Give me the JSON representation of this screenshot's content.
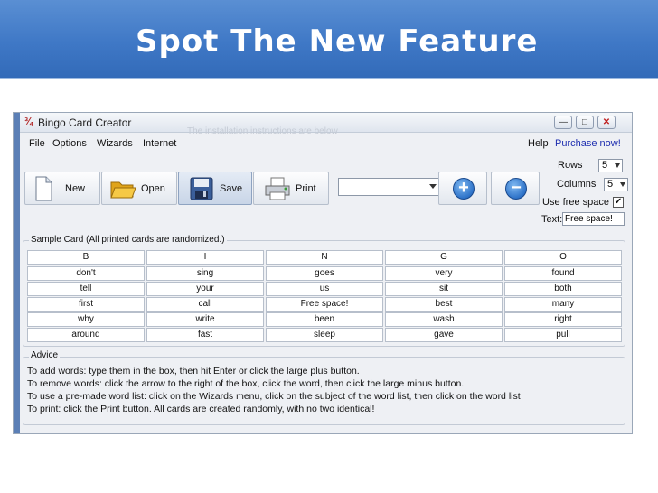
{
  "slide": {
    "title": "Spot The New Feature"
  },
  "window": {
    "title": "Bingo Card Creator",
    "ghost_text": "The installation instructions are below",
    "controls": {
      "minimize": "—",
      "maximize": "□",
      "close": "✕"
    }
  },
  "menu": {
    "file": "File",
    "options": "Options",
    "wizards": "Wizards",
    "internet": "Internet",
    "help": "Help",
    "purchase": "Purchase now!"
  },
  "toolbar": {
    "new_label": "New",
    "open_label": "Open",
    "save_label": "Save",
    "print_label": "Print",
    "word_combo_value": "",
    "add_symbol": "+",
    "remove_symbol": "−"
  },
  "settings": {
    "rows_label": "Rows",
    "rows_value": "5",
    "columns_label": "Columns",
    "columns_value": "5",
    "free_space_label": "Use free space",
    "free_space_checked": "✔",
    "text_label": "Text:",
    "text_value": "Free space!"
  },
  "sample_card": {
    "title": "Sample Card (All printed cards are randomized.)",
    "headers": [
      "B",
      "I",
      "N",
      "G",
      "O"
    ],
    "rows": [
      [
        "don't",
        "sing",
        "goes",
        "very",
        "found"
      ],
      [
        "tell",
        "your",
        "us",
        "sit",
        "both"
      ],
      [
        "first",
        "call",
        "Free space!",
        "best",
        "many"
      ],
      [
        "why",
        "write",
        "been",
        "wash",
        "right"
      ],
      [
        "around",
        "fast",
        "sleep",
        "gave",
        "pull"
      ]
    ]
  },
  "advice": {
    "title": "Advice",
    "lines": [
      "To add words: type them in the box, then hit Enter or click the large plus button.",
      "To remove words: click the arrow to the right of the box, click the word, then click the large minus button.",
      "To use a pre-made word list: click on the Wizards menu, click on the subject of the word list, then click on the word list",
      "To print: click the Print button.  All cards are created randomly, with no two identical!"
    ]
  },
  "colors": {
    "banner": "#3f78c6",
    "window_frame": "#5b7fb6",
    "purchase_link": "#1f2fb0",
    "action_button": "#2e73c9"
  },
  "icons": [
    "app-icon",
    "new-document-icon",
    "open-folder-icon",
    "save-disk-icon",
    "printer-icon",
    "plus-icon",
    "minus-icon"
  ]
}
